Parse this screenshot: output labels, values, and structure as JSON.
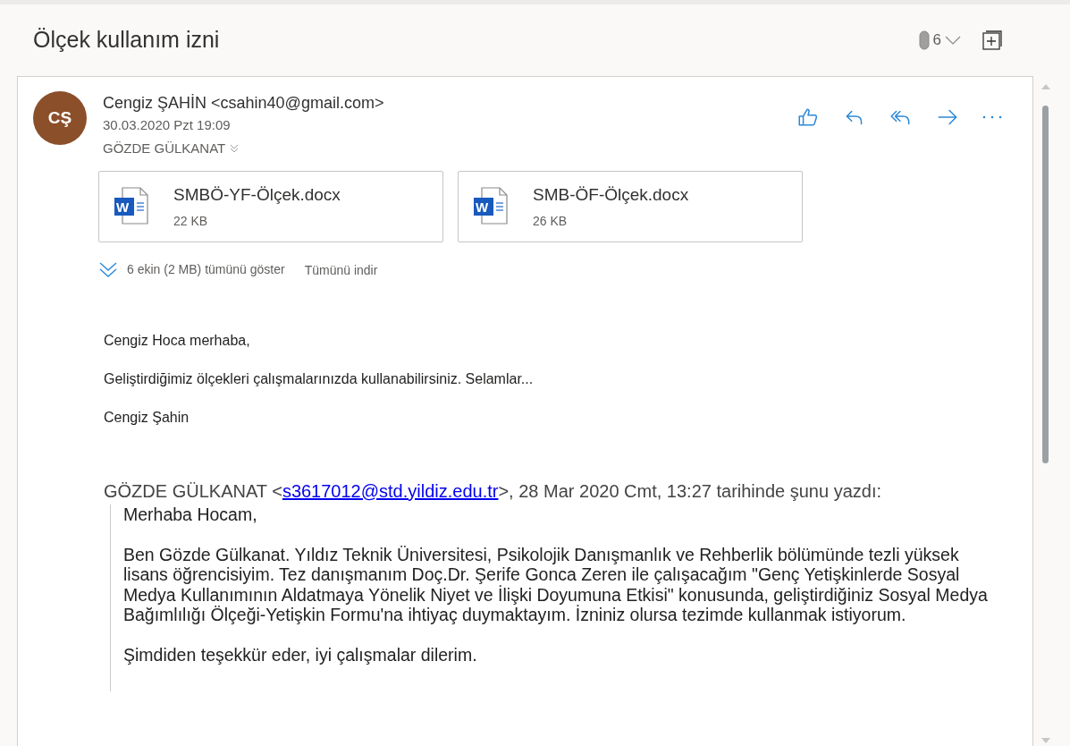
{
  "subject": "Ölçek kullanım izni",
  "attachment_count": "6",
  "message": {
    "avatar_initials": "CŞ",
    "sender": "Cengiz ŞAHİN <csahin40@gmail.com>",
    "date": "30.03.2020 Pzt 19:09",
    "recipient": "GÖZDE GÜLKANAT",
    "attachments": [
      {
        "icon_letter": "W",
        "name": "SMBÖ-YF-Ölçek.docx",
        "size": "22 KB"
      },
      {
        "icon_letter": "W",
        "name": "SMB-ÖF-Ölçek.docx",
        "size": "26 KB"
      }
    ],
    "show_all": "6 ekin (2 MB) tümünü göster",
    "download_all": "Tümünü indir",
    "body": [
      "Cengiz Hoca merhaba,",
      "Geliştirdiğimiz ölçekleri çalışmalarınızda kullanabilirsiniz. Selamlar...",
      "Cengiz Şahin"
    ],
    "quote_header": {
      "before": "GÖZDE GÜLKANAT <",
      "link": "s3617012@std.yildiz.edu.tr",
      "after": ">, 28 Mar 2020 Cmt, 13:27 tarihinde şunu yazdı:"
    },
    "quote": [
      "Merhaba Hocam,",
      "Ben Gözde Gülkanat. Yıldız Teknik Üniversitesi, Psikolojik Danışmanlık ve Rehberlik bölümünde tezli yüksek lisans öğrencisiyim. Tez danışmanım Doç.Dr. Şerife Gonca Zeren ile çalışacağım \"Genç Yetişkinlerde Sosyal Medya Kullanımının Aldatmaya Yönelik Niyet ve İlişki Doyumuna Etkisi\" konusunda, geliştirdiğiniz Sosyal Medya Bağımlılığı Ölçeği-Yetişkin Formu'na ihtiyaç duymaktayım. İzniniz olursa tezimde kullanmak istiyorum.",
      "Şimdiden teşekkür eder, iyi çalışmalar dilerim."
    ]
  }
}
